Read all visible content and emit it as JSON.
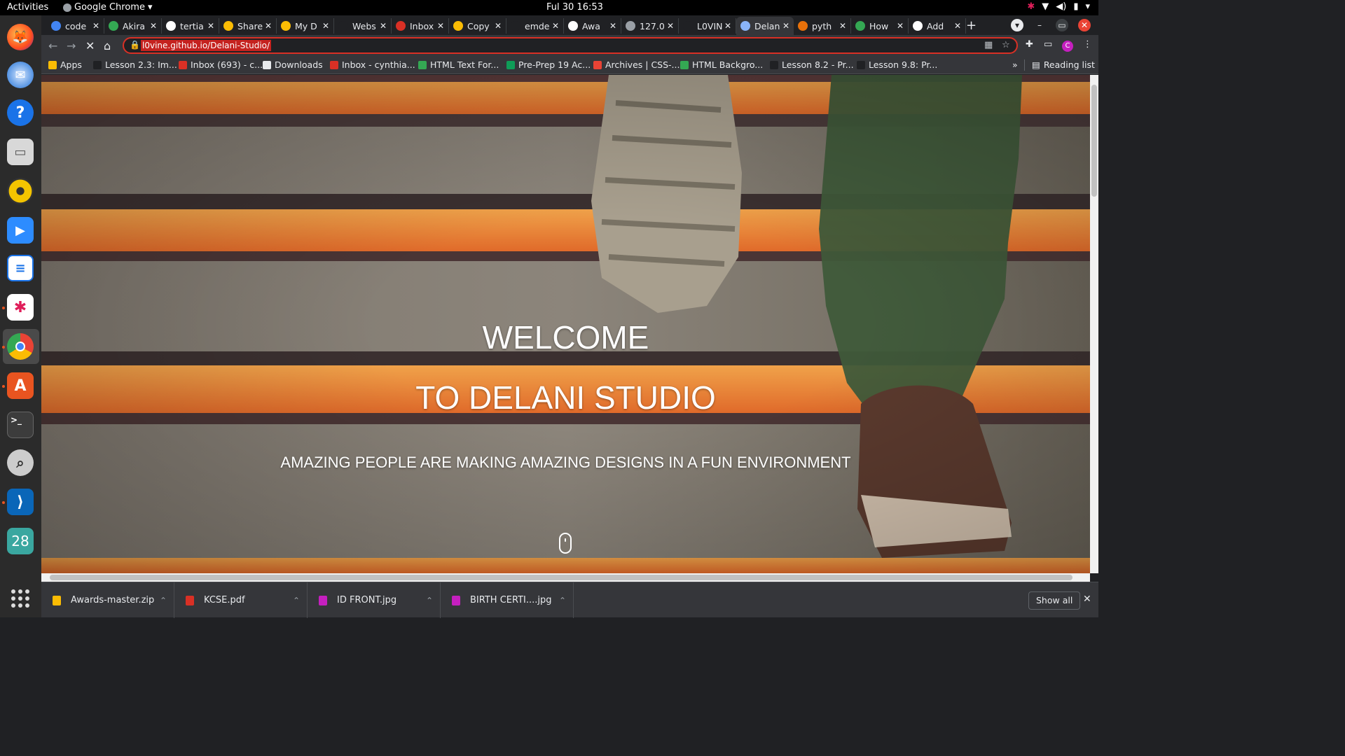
{
  "system_bar": {
    "activities": "Activities",
    "app_name": "Google Chrome",
    "clock": "Ful 30  16:53"
  },
  "dock": {
    "icons": [
      "firefox-icon",
      "thunderbird-icon",
      "help-icon",
      "files-icon",
      "rhythmbox-icon",
      "zoom-icon",
      "libreoffice-writer-icon",
      "slack-icon",
      "chrome-icon",
      "app-center-icon",
      "terminal-icon",
      "search-app-icon",
      "vscode-icon",
      "calendar-icon"
    ],
    "calendar_day": "28"
  },
  "tabs": [
    {
      "title": "code",
      "color": "#4285f4"
    },
    {
      "title": "Akira",
      "color": "#34a853"
    },
    {
      "title": "tertia",
      "color": "#ffffff"
    },
    {
      "title": "Share",
      "color": "#fbbc04"
    },
    {
      "title": "My D",
      "color": "#fbbc04"
    },
    {
      "title": "Webs",
      "color": "#202124"
    },
    {
      "title": "Inbox",
      "color": "#d93025"
    },
    {
      "title": "Copy",
      "color": "#fbbc04"
    },
    {
      "title": "emde",
      "color": "#202124"
    },
    {
      "title": "Awa",
      "color": "#ffffff"
    },
    {
      "title": "127.0",
      "color": "#9aa0a6"
    },
    {
      "title": "L0VIN",
      "color": "#202124"
    },
    {
      "title": "Delan",
      "color": "#8ab4f8"
    },
    {
      "title": "pyth",
      "color": "#e8710a"
    },
    {
      "title": "How",
      "color": "#34a853"
    },
    {
      "title": "Add",
      "color": "#ffffff"
    }
  ],
  "address_bar": {
    "url": "l0vine.github.io/Delani-Studio/"
  },
  "profile_initial": "C",
  "bookmarks": [
    {
      "label": "Apps",
      "color": "#fbbc04"
    },
    {
      "label": "Lesson 2.3: Im...",
      "color": "#202124"
    },
    {
      "label": "Inbox (693) - c...",
      "color": "#d93025"
    },
    {
      "label": "Downloads",
      "color": "#e8eaed"
    },
    {
      "label": "Inbox - cynthia...",
      "color": "#d93025"
    },
    {
      "label": "HTML Text For...",
      "color": "#34a853"
    },
    {
      "label": "Pre-Prep 19 Ac...",
      "color": "#0f9d58"
    },
    {
      "label": "Archives | CSS-...",
      "color": "#ea4335"
    },
    {
      "label": "HTML Backgro...",
      "color": "#34a853"
    },
    {
      "label": "Lesson 8.2 - Pr...",
      "color": "#202124"
    },
    {
      "label": "Lesson 9.8: Pr...",
      "color": "#202124"
    }
  ],
  "bookmarks_overflow": "»",
  "reading_list": "Reading list",
  "hero": {
    "line1": "WELCOME",
    "line2": "TO DELANI STUDIO",
    "tagline": "AMAZING PEOPLE ARE MAKING AMAZING DESIGNS IN A FUN ENVIRONMENT"
  },
  "downloads": [
    {
      "name": "Awards-master.zip",
      "color": "#fbbc04"
    },
    {
      "name": "KCSE.pdf",
      "color": "#d93025"
    },
    {
      "name": "ID FRONT.jpg",
      "color": "#c51fbf"
    },
    {
      "name": "BIRTH CERTI....jpg",
      "color": "#c51fbf"
    }
  ],
  "show_all": "Show all"
}
